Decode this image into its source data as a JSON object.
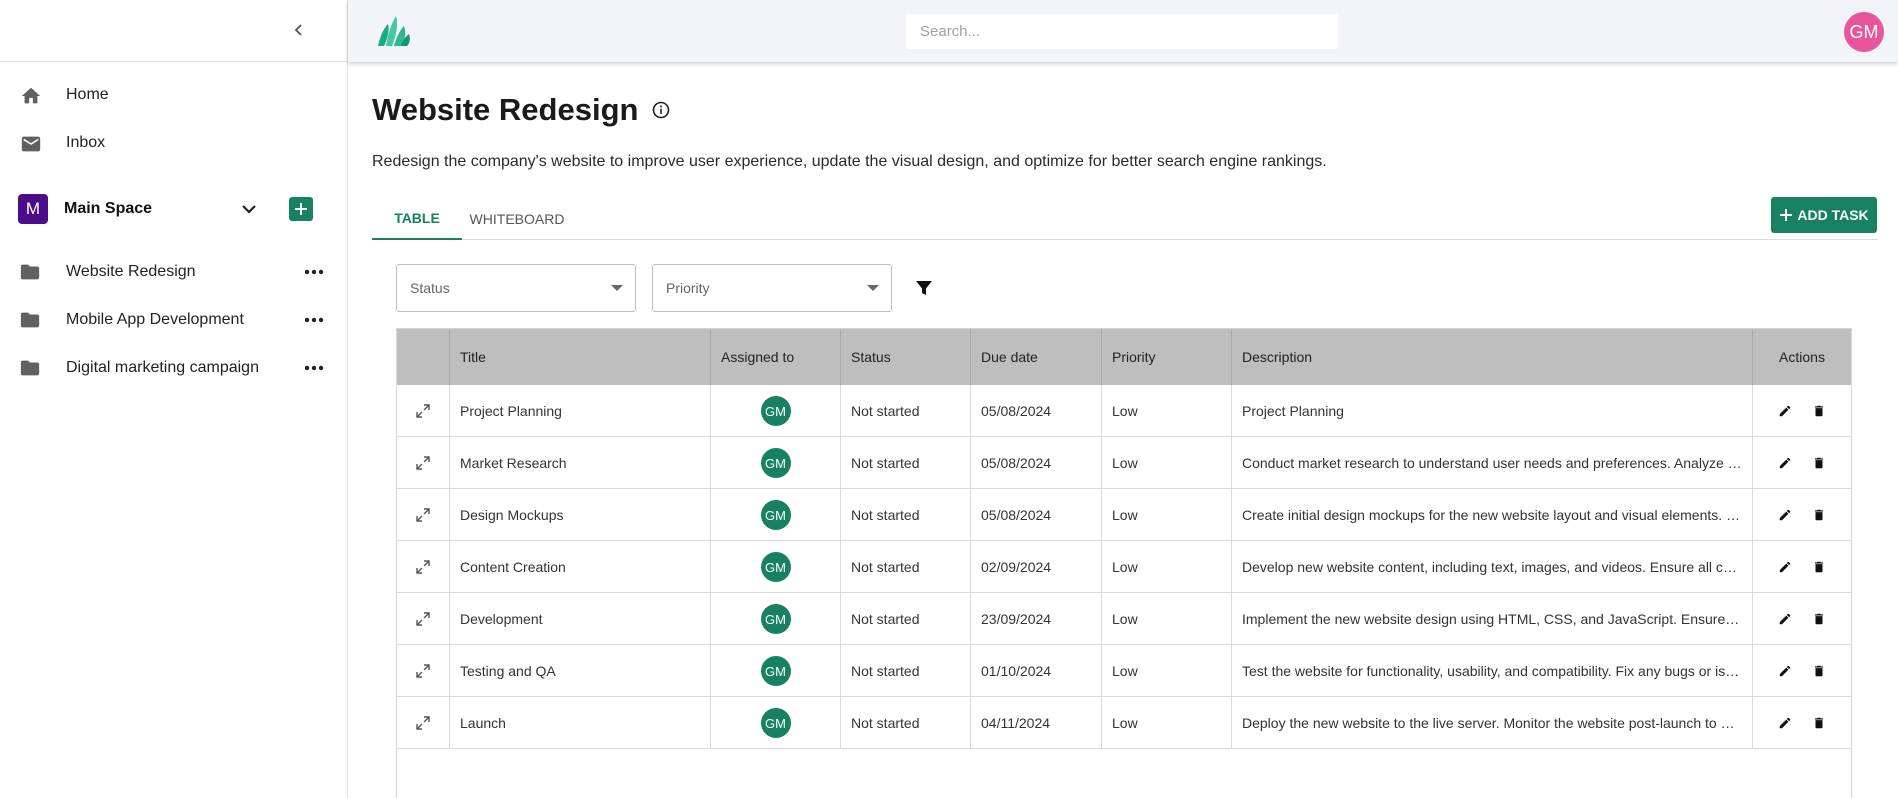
{
  "sidebar": {
    "nav": [
      {
        "label": "Home",
        "icon": "home-icon"
      },
      {
        "label": "Inbox",
        "icon": "mail-icon"
      }
    ],
    "space": {
      "initial": "M",
      "name": "Main Space",
      "color": "#4b0d8a"
    },
    "projects": [
      {
        "label": "Website Redesign"
      },
      {
        "label": "Mobile App Development"
      },
      {
        "label": "Digital marketing campaign"
      }
    ]
  },
  "header": {
    "search_placeholder": "Search...",
    "user_initials": "GM"
  },
  "page": {
    "title": "Website Redesign",
    "description": "Redesign the company's website to improve user experience, update the visual design, and optimize for better search engine rankings.",
    "tabs": [
      "TABLE",
      "WHITEBOARD"
    ],
    "add_task_label": "ADD TASK",
    "filters": {
      "status_placeholder": "Status",
      "priority_placeholder": "Priority"
    }
  },
  "table": {
    "columns": [
      "Title",
      "Assigned to",
      "Status",
      "Due date",
      "Priority",
      "Description",
      "Actions"
    ],
    "rows": [
      {
        "title": "Project Planning",
        "assignee": "GM",
        "status": "Not started",
        "due": "05/08/2024",
        "priority": "Low",
        "description": "Project Planning"
      },
      {
        "title": "Market Research",
        "assignee": "GM",
        "status": "Not started",
        "due": "05/08/2024",
        "priority": "Low",
        "description": "Conduct market research to understand user needs and preferences. Analyze competitor websites and industry trends."
      },
      {
        "title": "Design Mockups",
        "assignee": "GM",
        "status": "Not started",
        "due": "05/08/2024",
        "priority": "Low",
        "description": "Create initial design mockups for the new website layout and visual elements. Gather feedback from stakeholders."
      },
      {
        "title": "Content Creation",
        "assignee": "GM",
        "status": "Not started",
        "due": "02/09/2024",
        "priority": "Low",
        "description": "Develop new website content, including text, images, and videos. Ensure all content is optimized for SEO."
      },
      {
        "title": "Development",
        "assignee": "GM",
        "status": "Not started",
        "due": "23/09/2024",
        "priority": "Low",
        "description": "Implement the new website design using HTML, CSS, and JavaScript. Ensure the website is responsive."
      },
      {
        "title": "Testing and QA",
        "assignee": "GM",
        "status": "Not started",
        "due": "01/10/2024",
        "priority": "Low",
        "description": "Test the website for functionality, usability, and compatibility. Fix any bugs or issues found."
      },
      {
        "title": "Launch",
        "assignee": "GM",
        "status": "Not started",
        "due": "04/11/2024",
        "priority": "Low",
        "description": "Deploy the new website to the live server. Monitor the website post-launch to ensure stability."
      }
    ]
  },
  "colors": {
    "accent": "#168262",
    "avatar_user": "#e8559b",
    "table_header": "#bebebe"
  }
}
